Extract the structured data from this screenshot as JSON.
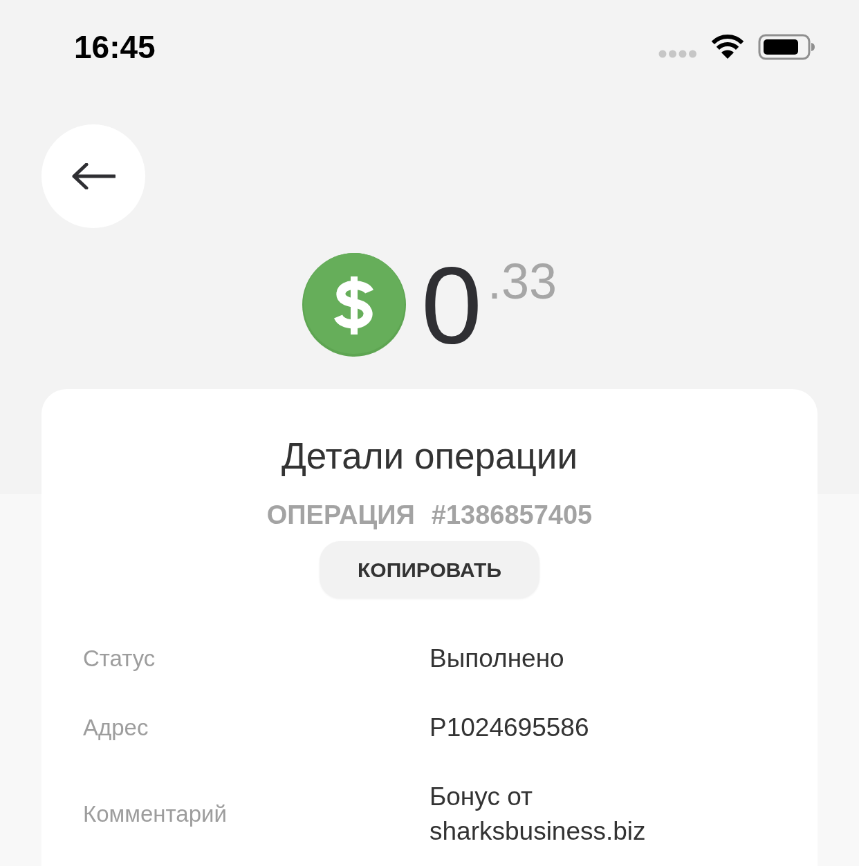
{
  "status_bar": {
    "time": "16:45"
  },
  "amount": {
    "integer": "0",
    "fraction": ".33"
  },
  "details": {
    "title": "Детали операции",
    "operation_label": "ОПЕРАЦИЯ",
    "operation_number": "#1386857405",
    "copy_button": "КОПИРОВАТЬ",
    "rows": [
      {
        "label": "Статус",
        "value": "Выполнено"
      },
      {
        "label": "Адрес",
        "value": "P1024695586"
      },
      {
        "label": "Комментарий",
        "value": "Бонус от sharksbusiness.biz"
      }
    ]
  }
}
